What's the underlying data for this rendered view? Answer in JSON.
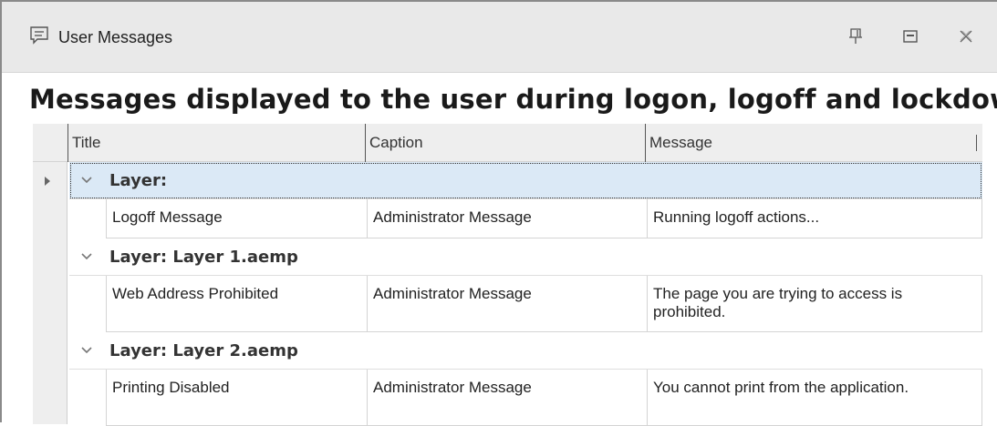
{
  "window": {
    "title": "User Messages",
    "icons": {
      "app": "message-icon",
      "pin": "pin-icon",
      "maximize": "maximize-icon",
      "close": "close-icon"
    }
  },
  "heading": "Messages displayed to the user during logon, logoff and lockdown",
  "grid": {
    "columns": [
      "Title",
      "Caption",
      "Message"
    ],
    "groups": [
      {
        "label": "Layer:",
        "selected": true,
        "rows": [
          {
            "title": "Logoff Message",
            "caption": "Administrator Message",
            "message": "Running logoff actions..."
          }
        ]
      },
      {
        "label": "Layer: Layer 1.aemp",
        "selected": false,
        "rows": [
          {
            "title": "Web Address Prohibited",
            "caption": "Administrator Message",
            "message": "The page you are trying to access is prohibited."
          }
        ]
      },
      {
        "label": "Layer: Layer 2.aemp",
        "selected": false,
        "rows": [
          {
            "title": "Printing Disabled",
            "caption": "Administrator Message",
            "message": "You cannot print from the application."
          }
        ]
      }
    ]
  },
  "colors": {
    "selection": "#dbe9f6",
    "header_bg": "#eeeeee",
    "titlebar_bg": "#e9e9e9"
  }
}
